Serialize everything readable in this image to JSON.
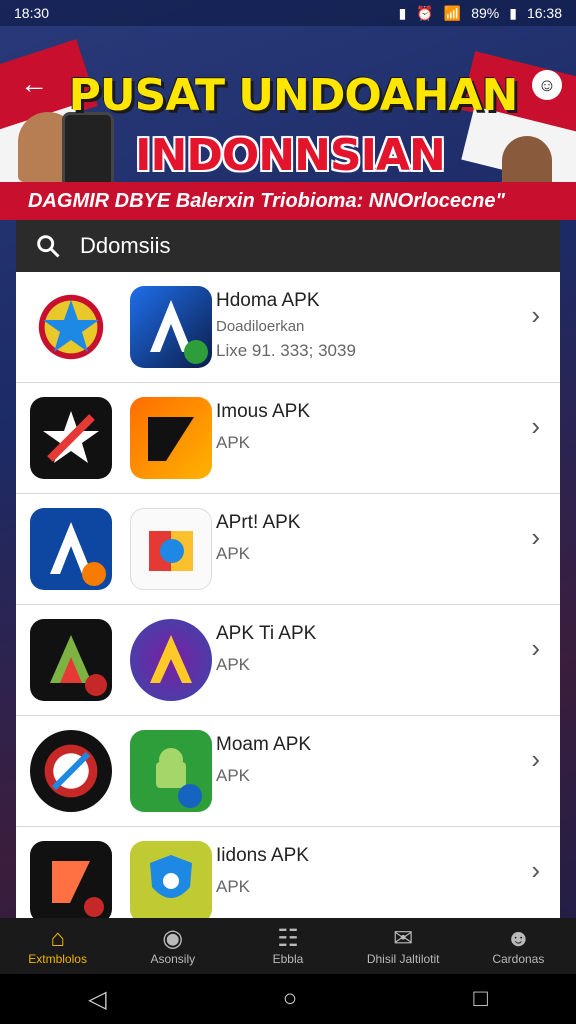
{
  "status_bar": {
    "time": "18:30",
    "battery": "89%",
    "clock_right": "16:38"
  },
  "header": {
    "title_line1": "PUSAT UNDOAHAN",
    "title_line2": "INDONNSIAN",
    "ribbon": "DAGMIR DBYE Balerxin Triobioma: NNOrlocecne\"",
    "colors": {
      "title": "#ffe600",
      "subtitle": "#e3142b",
      "ribbon": "#c8102e"
    }
  },
  "search": {
    "label": "Ddomsiis"
  },
  "apps": [
    {
      "title": "Hdoma APK",
      "subtitle": "Doadiloerkan",
      "date": "Lixe 91. 333; 3039"
    },
    {
      "title": "Imous APK",
      "subtitle": "APK"
    },
    {
      "title": "APrt! APK",
      "subtitle": "APK"
    },
    {
      "title": "APK Ti APK",
      "subtitle": "APK"
    },
    {
      "title": "Moam APK",
      "subtitle": "APK"
    },
    {
      "title": "Iidons APK",
      "subtitle": "APK"
    }
  ],
  "bottom_nav": [
    {
      "label": "Extmblolos",
      "icon": "home-icon",
      "active": true
    },
    {
      "label": "Asonsily",
      "icon": "globe-icon",
      "active": false
    },
    {
      "label": "Ebbla",
      "icon": "grid-icon",
      "active": false
    },
    {
      "label": "Dhisil Jaltilotit",
      "icon": "chat-icon",
      "active": false
    },
    {
      "label": "Cardonas",
      "icon": "person-icon",
      "active": false
    }
  ],
  "system_nav": {
    "back": "◁",
    "home": "○",
    "recents": "□"
  }
}
